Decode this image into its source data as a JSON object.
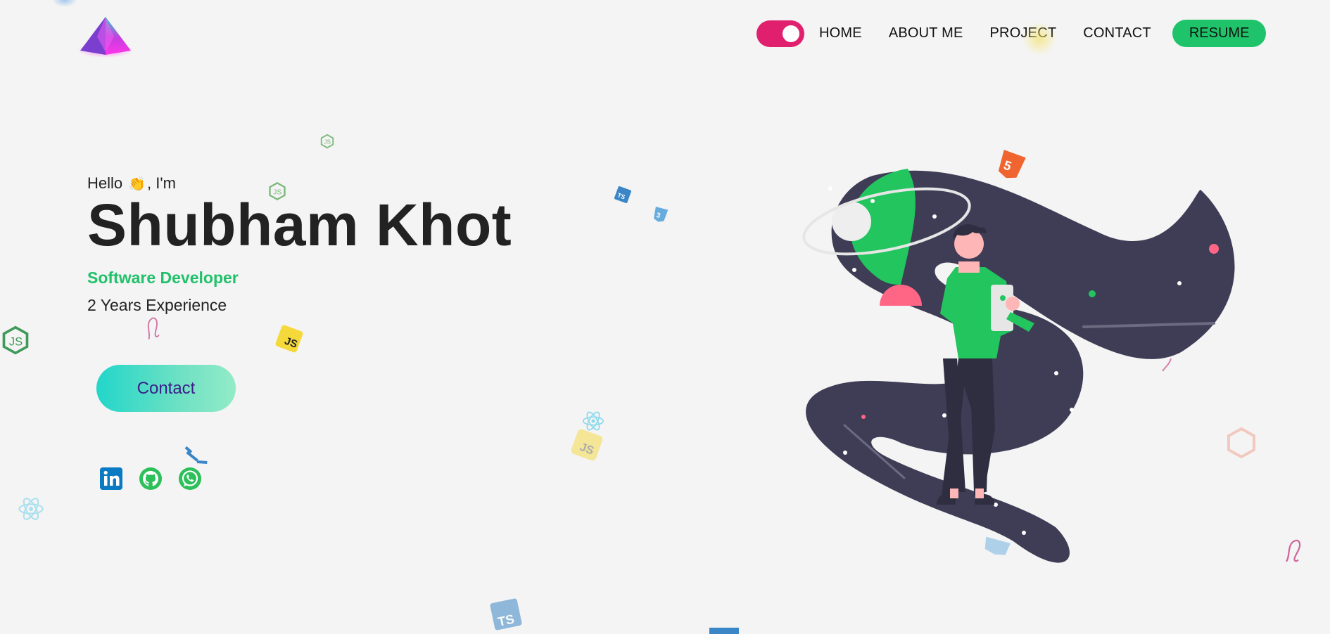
{
  "header": {
    "logo_icon": "prism-logo-icon",
    "theme_toggle": {
      "state": "on",
      "color": "#e0206e"
    },
    "nav": [
      "HOME",
      "ABOUT ME",
      "PROJECT",
      "CONTACT"
    ],
    "resume_label": "RESUME",
    "resume_color": "#1fc46a"
  },
  "hero": {
    "greeting_before": "Hello",
    "greeting_emoji": "👏",
    "greeting_after": ", I'm",
    "name": "Shubham Khot",
    "role": "Software Developer",
    "experience": "2 Years Experience",
    "contact_label": "Contact",
    "accent_color": "#21c16b"
  },
  "social": [
    "linkedin-icon",
    "github-icon",
    "whatsapp-icon"
  ],
  "decorations": [
    "nodejs-icon",
    "javascript-icon",
    "typescript-icon",
    "css3-icon",
    "html5-icon",
    "react-icon",
    "sass-icon"
  ],
  "illustration": "developer-on-space-path-illustration"
}
